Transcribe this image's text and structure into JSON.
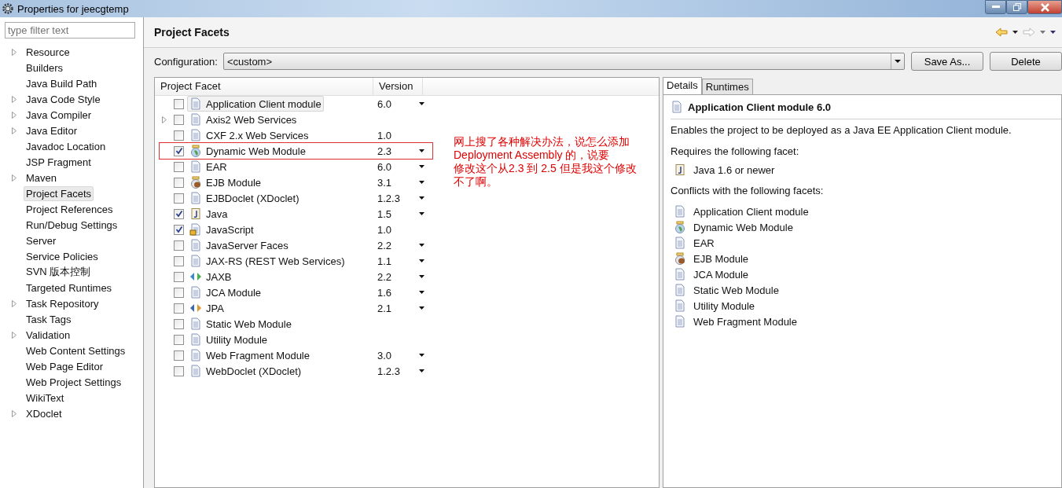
{
  "window": {
    "title": "Properties for jeecgtemp"
  },
  "filter": {
    "placeholder": "type filter text"
  },
  "sidebar": {
    "items": [
      {
        "label": "Resource",
        "expandable": true,
        "selected": false
      },
      {
        "label": "Builders",
        "expandable": false,
        "selected": false
      },
      {
        "label": "Java Build Path",
        "expandable": false,
        "selected": false
      },
      {
        "label": "Java Code Style",
        "expandable": true,
        "selected": false
      },
      {
        "label": "Java Compiler",
        "expandable": true,
        "selected": false
      },
      {
        "label": "Java Editor",
        "expandable": true,
        "selected": false
      },
      {
        "label": "Javadoc Location",
        "expandable": false,
        "selected": false
      },
      {
        "label": "JSP Fragment",
        "expandable": false,
        "selected": false
      },
      {
        "label": "Maven",
        "expandable": true,
        "selected": false
      },
      {
        "label": "Project Facets",
        "expandable": false,
        "selected": true
      },
      {
        "label": "Project References",
        "expandable": false,
        "selected": false
      },
      {
        "label": "Run/Debug Settings",
        "expandable": false,
        "selected": false
      },
      {
        "label": "Server",
        "expandable": false,
        "selected": false
      },
      {
        "label": "Service Policies",
        "expandable": false,
        "selected": false
      },
      {
        "label": "SVN 版本控制",
        "expandable": false,
        "selected": false
      },
      {
        "label": "Targeted Runtimes",
        "expandable": false,
        "selected": false
      },
      {
        "label": "Task Repository",
        "expandable": true,
        "selected": false
      },
      {
        "label": "Task Tags",
        "expandable": false,
        "selected": false
      },
      {
        "label": "Validation",
        "expandable": true,
        "selected": false
      },
      {
        "label": "Web Content Settings",
        "expandable": false,
        "selected": false
      },
      {
        "label": "Web Page Editor",
        "expandable": false,
        "selected": false
      },
      {
        "label": "Web Project Settings",
        "expandable": false,
        "selected": false
      },
      {
        "label": "WikiText",
        "expandable": false,
        "selected": false
      },
      {
        "label": "XDoclet",
        "expandable": true,
        "selected": false
      }
    ]
  },
  "page": {
    "title": "Project Facets",
    "configuration_label": "Configuration:",
    "configuration_value": "<custom>",
    "buttons": [
      "Save As...",
      "Delete"
    ]
  },
  "table": {
    "columns": [
      "Project Facet",
      "Version"
    ],
    "rows": [
      {
        "name": "Application Client module",
        "version": "6.0",
        "kind": "doc",
        "checked": false,
        "selected": true,
        "expandable": false,
        "dropdown": true,
        "annotated": false
      },
      {
        "name": "Axis2 Web Services",
        "version": "",
        "kind": "doc",
        "checked": false,
        "selected": false,
        "expandable": true,
        "dropdown": false,
        "annotated": false
      },
      {
        "name": "CXF 2.x Web Services",
        "version": "1.0",
        "kind": "doc",
        "checked": false,
        "selected": false,
        "expandable": false,
        "dropdown": false,
        "annotated": false
      },
      {
        "name": "Dynamic Web Module",
        "version": "2.3",
        "kind": "globe",
        "checked": true,
        "selected": false,
        "expandable": false,
        "dropdown": true,
        "annotated": true
      },
      {
        "name": "EAR",
        "version": "6.0",
        "kind": "doc",
        "checked": false,
        "selected": false,
        "expandable": false,
        "dropdown": true,
        "annotated": false
      },
      {
        "name": "EJB Module",
        "version": "3.1",
        "kind": "bean",
        "checked": false,
        "selected": false,
        "expandable": false,
        "dropdown": true,
        "annotated": false
      },
      {
        "name": "EJBDoclet (XDoclet)",
        "version": "1.2.3",
        "kind": "doc",
        "checked": false,
        "selected": false,
        "expandable": false,
        "dropdown": true,
        "annotated": false
      },
      {
        "name": "Java",
        "version": "1.5",
        "kind": "java",
        "checked": true,
        "selected": false,
        "expandable": false,
        "dropdown": true,
        "annotated": false
      },
      {
        "name": "JavaScript",
        "version": "1.0",
        "kind": "lock",
        "checked": true,
        "selected": false,
        "expandable": false,
        "dropdown": false,
        "annotated": false
      },
      {
        "name": "JavaServer Faces",
        "version": "2.2",
        "kind": "doc",
        "checked": false,
        "selected": false,
        "expandable": false,
        "dropdown": true,
        "annotated": false
      },
      {
        "name": "JAX-RS (REST Web Services)",
        "version": "1.1",
        "kind": "doc",
        "checked": false,
        "selected": false,
        "expandable": false,
        "dropdown": true,
        "annotated": false
      },
      {
        "name": "JAXB",
        "version": "2.2",
        "kind": "arrows-green",
        "checked": false,
        "selected": false,
        "expandable": false,
        "dropdown": true,
        "annotated": false
      },
      {
        "name": "JCA Module",
        "version": "1.6",
        "kind": "doc",
        "checked": false,
        "selected": false,
        "expandable": false,
        "dropdown": true,
        "annotated": false
      },
      {
        "name": "JPA",
        "version": "2.1",
        "kind": "arrows-orange",
        "checked": false,
        "selected": false,
        "expandable": false,
        "dropdown": true,
        "annotated": false
      },
      {
        "name": "Static Web Module",
        "version": "",
        "kind": "doc",
        "checked": false,
        "selected": false,
        "expandable": false,
        "dropdown": false,
        "annotated": false
      },
      {
        "name": "Utility Module",
        "version": "",
        "kind": "doc",
        "checked": false,
        "selected": false,
        "expandable": false,
        "dropdown": false,
        "annotated": false
      },
      {
        "name": "Web Fragment Module",
        "version": "3.0",
        "kind": "doc",
        "checked": false,
        "selected": false,
        "expandable": false,
        "dropdown": true,
        "annotated": false
      },
      {
        "name": "WebDoclet (XDoclet)",
        "version": "1.2.3",
        "kind": "doc",
        "checked": false,
        "selected": false,
        "expandable": false,
        "dropdown": true,
        "annotated": false
      }
    ]
  },
  "annotation": [
    "网上搜了各种解决办法，说怎么添加",
    "Deployment Assembly 的，说要",
    "修改这个从2.3 到 2.5 但是我这个修改",
    "不了啊。"
  ],
  "details": {
    "tabs": [
      {
        "label": "Details",
        "selected": true
      },
      {
        "label": "Runtimes",
        "selected": false
      }
    ],
    "heading": "Application Client module 6.0",
    "description": "Enables the project to be deployed as a Java EE Application Client module.",
    "requires_label": "Requires the following facet:",
    "requires": [
      {
        "name": "Java 1.6 or newer",
        "kind": "java"
      }
    ],
    "conflicts_label": "Conflicts with the following facets:",
    "conflicts": [
      {
        "name": "Application Client module",
        "kind": "doc"
      },
      {
        "name": "Dynamic Web Module",
        "kind": "globe"
      },
      {
        "name": "EAR",
        "kind": "doc"
      },
      {
        "name": "EJB Module",
        "kind": "bean"
      },
      {
        "name": "JCA Module",
        "kind": "doc"
      },
      {
        "name": "Static Web Module",
        "kind": "doc"
      },
      {
        "name": "Utility Module",
        "kind": "doc"
      },
      {
        "name": "Web Fragment Module",
        "kind": "doc"
      }
    ]
  }
}
